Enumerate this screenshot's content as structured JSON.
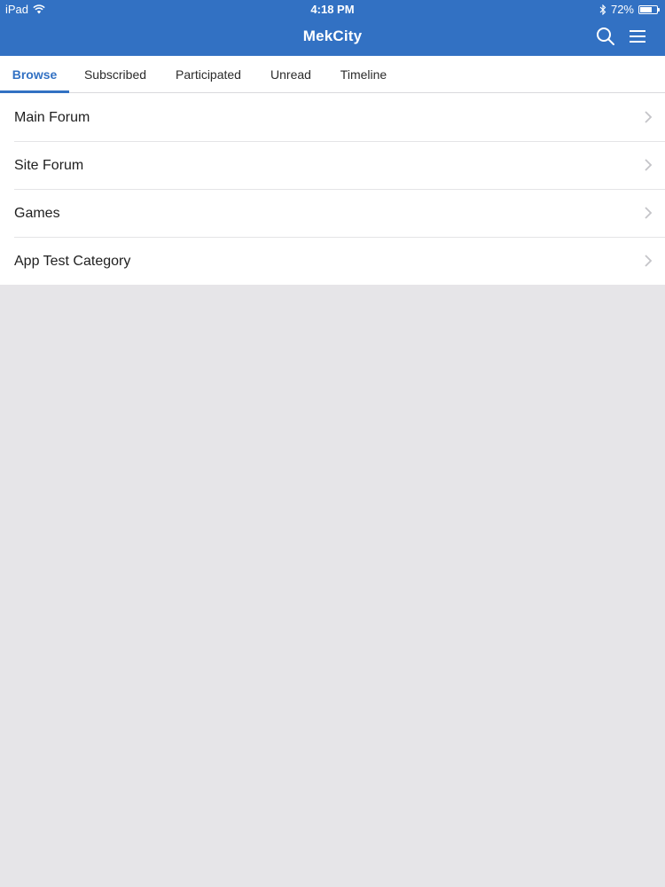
{
  "status_bar": {
    "device": "iPad",
    "time": "4:18 PM",
    "battery_text": "72%",
    "battery_level": 0.72
  },
  "navbar": {
    "title": "MekCity",
    "icons": [
      "search-icon",
      "menu-icon"
    ]
  },
  "tabs": [
    {
      "label": "Browse",
      "active": true
    },
    {
      "label": "Subscribed",
      "active": false
    },
    {
      "label": "Participated",
      "active": false
    },
    {
      "label": "Unread",
      "active": false
    },
    {
      "label": "Timeline",
      "active": false
    }
  ],
  "forums": [
    {
      "label": "Main Forum"
    },
    {
      "label": "Site Forum"
    },
    {
      "label": "Games"
    },
    {
      "label": "App Test Category"
    }
  ],
  "colors": {
    "brand": "#3271c3",
    "background": "#e6e5e8",
    "text": "#1f1f1f"
  }
}
